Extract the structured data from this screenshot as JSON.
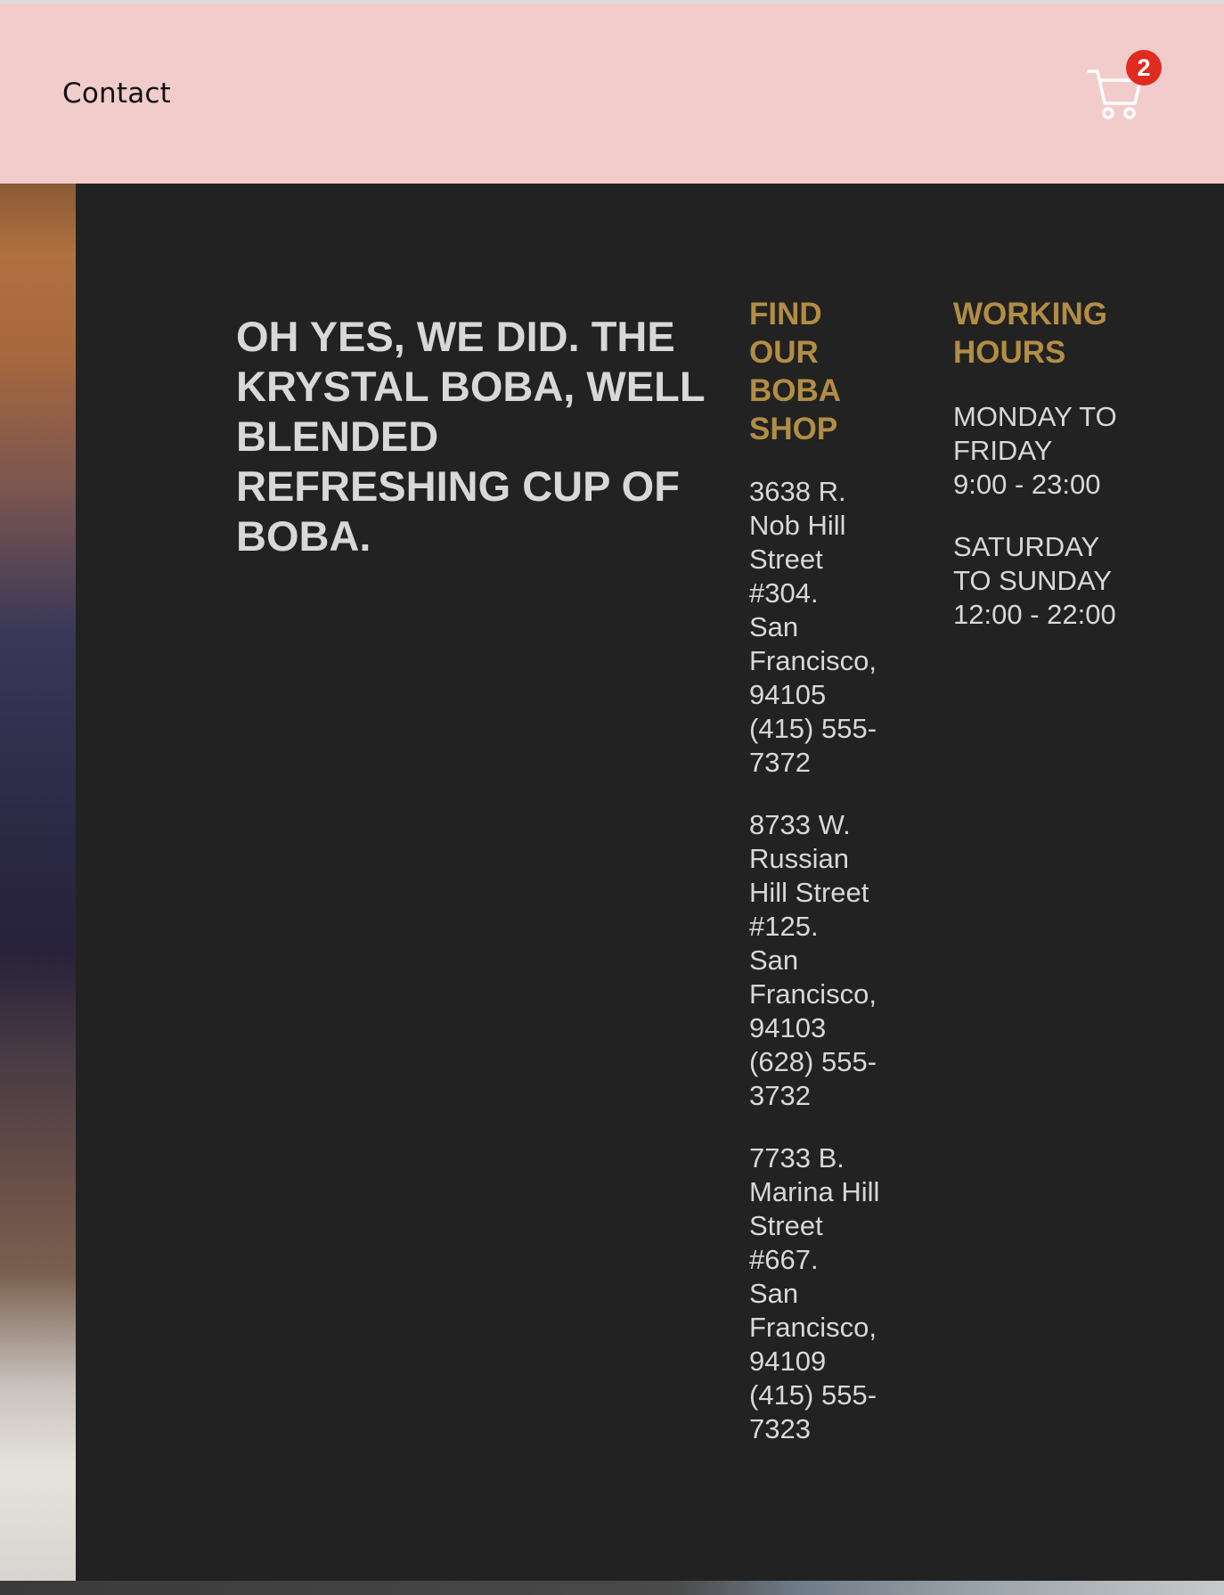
{
  "nav": {
    "contact_label": "Contact",
    "cart_count": "2",
    "cart_icon": "shopping-cart-icon"
  },
  "hero": {
    "headline": "OH YES, WE DID. THE KRYSTAL BOBA, WELL BLENDED REFRESHING CUP OF BOBA."
  },
  "find": {
    "heading": "FIND OUR BOBA SHOP",
    "addresses": [
      "3638 R. Nob Hill Street #304.\nSan Francisco, 94105\n(415) 555-7372",
      "8733 W. Russian Hill Street #125.\nSan Francisco, 94103\n(628) 555-3732",
      "7733 B. Marina Hill Street #667.\nSan Francisco, 94109\n(415) 555-7323"
    ]
  },
  "hours": {
    "heading": "WORKING HOURS",
    "entries": [
      {
        "days": "MONDAY TO FRIDAY",
        "time": "9:00 - 23:00"
      },
      {
        "days": "SATURDAY TO SUNDAY",
        "time": "12:00 - 22:00"
      }
    ]
  },
  "colors": {
    "header_bg": "#f1cccb",
    "main_bg": "#222222",
    "accent_gold": "#b28d44",
    "badge_red": "#e02b20",
    "text_light": "#d8d8d8"
  }
}
